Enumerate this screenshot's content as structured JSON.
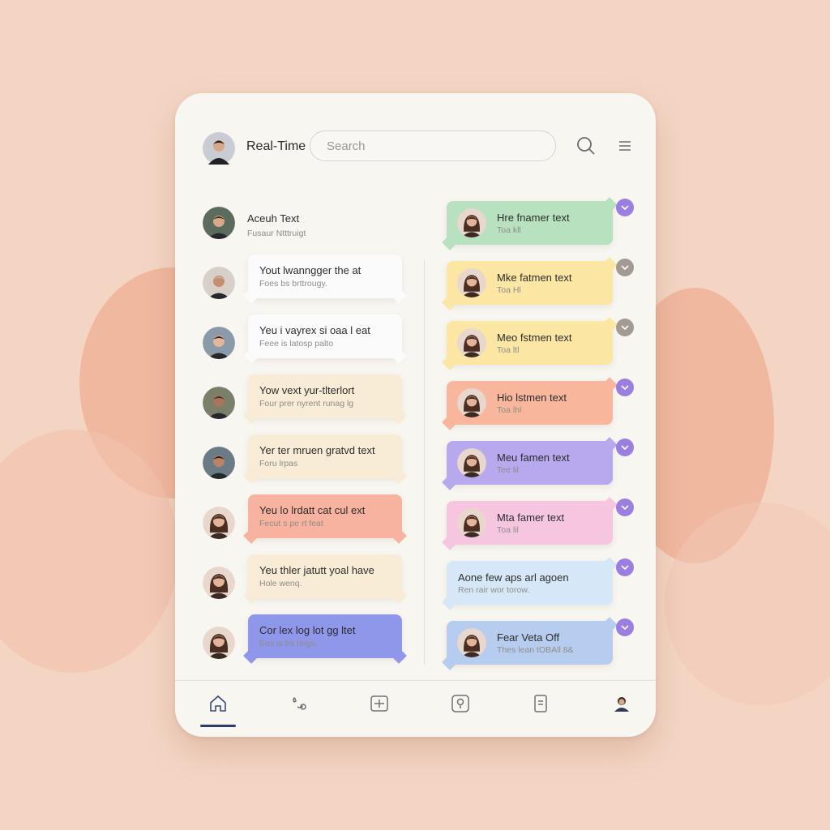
{
  "header": {
    "title": "Real-Time",
    "search_placeholder": "Search"
  },
  "colors": {
    "background": "#f4d5c4",
    "green": "#b8e2bf",
    "yellow": "#fbe6a3",
    "orange": "#f8b79d",
    "purple": "#b8a9ef",
    "pink": "#f6c6e0",
    "lightblue": "#d6e8f8",
    "blue": "#b7cdf0",
    "peach": "#f8b3a0",
    "cream": "#f8ecd6",
    "white": "#fbfbfb",
    "indigo": "#8f97ea",
    "check_purple": "#9a7fe0",
    "check_gray": "#a39b92"
  },
  "left_messages": [
    {
      "title": "Aceuh Text",
      "subtitle": "Fusaur Ntttruigt",
      "style": "plain"
    },
    {
      "title": "Yout lwanngger the at",
      "subtitle": "Foes bs brttrougy.",
      "style": "white"
    },
    {
      "title": "Yeu i vayrex si oaa l eat",
      "subtitle": "Feee is latosp palto",
      "style": "white"
    },
    {
      "title": "Yow vext yur-tlterlort",
      "subtitle": "Four prer nyrent runag lg",
      "style": "cream"
    },
    {
      "title": "Yer ter mruen gratvd text",
      "subtitle": "Foru lrpas",
      "style": "cream"
    },
    {
      "title": "Yeu lo lrdatt cat cul ext",
      "subtitle": "Fecut s pe rt feat",
      "style": "peach"
    },
    {
      "title": "Yeu thler jatutt yoal have",
      "subtitle": "Hole wenq.",
      "style": "cream"
    },
    {
      "title": "Cor lex log lot gg ltet",
      "subtitle": "Eos is trs rings.",
      "style": "indigo"
    }
  ],
  "right_messages": [
    {
      "title": "Hre fnamer text",
      "subtitle": "Toa kll",
      "color": "green",
      "check": "purple"
    },
    {
      "title": "Mke fatmen text",
      "subtitle": "Toa Hl",
      "color": "yellow",
      "check": "gray"
    },
    {
      "title": "Meo fstmen text",
      "subtitle": "Toa ltl",
      "color": "yellow",
      "check": "gray"
    },
    {
      "title": "Hio lstmen text",
      "subtitle": "Toa lhl",
      "color": "orange",
      "check": "purple"
    },
    {
      "title": "Meu famen text",
      "subtitle": "Tee lil",
      "color": "purple",
      "check": "purple"
    },
    {
      "title": "Mta famer text",
      "subtitle": "Toa lil",
      "color": "pink",
      "check": "purple"
    },
    {
      "title": "Aone few aps arl agoen",
      "subtitle": "Ren rair wor torow.",
      "color": "lightblue",
      "check": "purple"
    },
    {
      "title": "Fear Veta Off",
      "subtitle": "Thes lean tOBAll 8&",
      "color": "blue",
      "check": "purple"
    }
  ],
  "nav": [
    {
      "name": "nav-home",
      "icon": "home-icon",
      "active": true
    },
    {
      "name": "nav-calls",
      "icon": "call-icon",
      "active": false
    },
    {
      "name": "nav-new",
      "icon": "add-square-icon",
      "active": false
    },
    {
      "name": "nav-location",
      "icon": "pin-icon",
      "active": false
    },
    {
      "name": "nav-files",
      "icon": "document-icon",
      "active": false
    },
    {
      "name": "nav-profile",
      "icon": "profile-icon",
      "active": false
    }
  ]
}
